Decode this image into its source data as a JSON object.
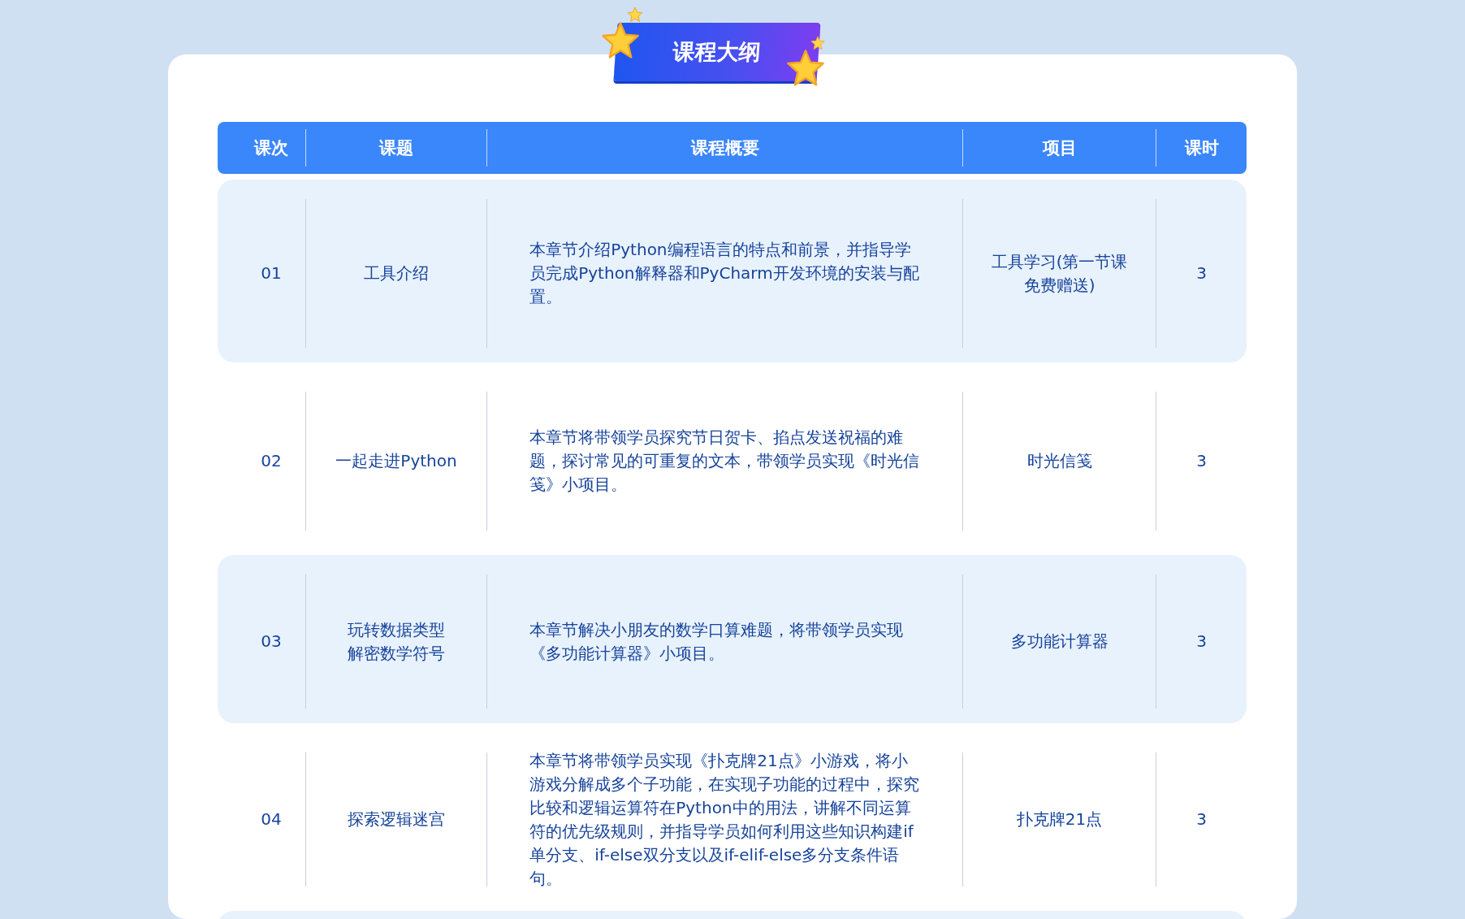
{
  "banner": {
    "title": "课程大纲"
  },
  "table": {
    "columns": [
      "课次",
      "课题",
      "课程概要",
      "项目",
      "课时"
    ],
    "rows": [
      {
        "cells": [
          "01",
          "工具介绍",
          "本章节介绍Python编程语言的特点和前景，并指导学员完成Python解释器和PyCharm开发环境的安装与配置。",
          "工具学习(第一节课免费赠送)",
          "3"
        ]
      },
      {
        "cells": [
          "02",
          "一起走进Python",
          "本章节将带领学员探究节日贺卡、掐点发送祝福的难题，探讨常见的可重复的文本，带领学员实现《时光信笺》小项目。",
          "时光信笺",
          "3"
        ]
      },
      {
        "cells": [
          "03",
          [
            "玩转数据类型",
            "解密数学符号"
          ],
          "本章节解决小朋友的数学口算难题，将带领学员实现《多功能计算器》小项目。",
          "多功能计算器",
          "3"
        ]
      },
      {
        "cells": [
          "04",
          "探索逻辑迷宫",
          "本章节将带领学员实现《扑克牌21点》小游戏，将小游戏分解成多个子功能，在实现子功能的过程中，探究比较和逻辑运算符在Python中的用法，讲解不同运算符的优先级规则，并指导学员如何利用这些知识构建if单分支、if-else双分支以及if-elif-else多分支条件语句。",
          "扑克牌21点",
          "3"
        ]
      }
    ]
  }
}
